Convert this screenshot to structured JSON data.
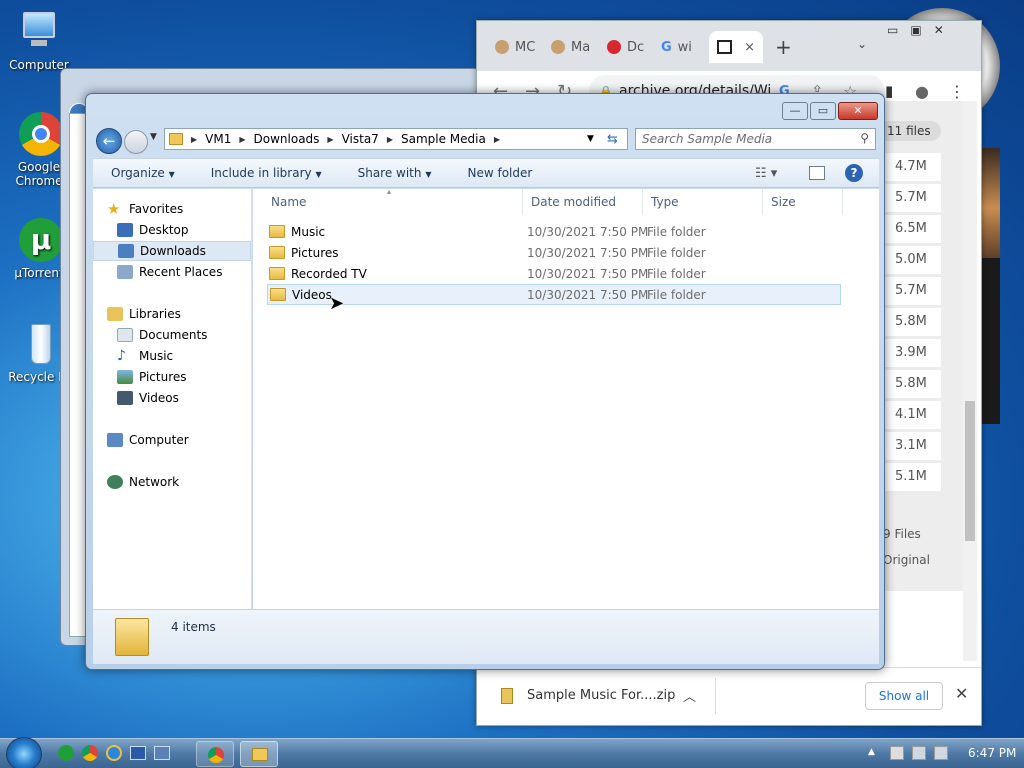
{
  "desktop": {
    "icons": [
      {
        "label": "Computer"
      },
      {
        "label": "Google Chrome",
        "line1": "Google",
        "line2": "Chrome"
      },
      {
        "label": "µTorrent"
      },
      {
        "label": "Recycle Bi"
      }
    ]
  },
  "chrome": {
    "tabs": [
      {
        "label": "MC"
      },
      {
        "label": "Ma"
      },
      {
        "label": "Dc"
      },
      {
        "label": "wi"
      },
      {
        "label": ""
      }
    ],
    "new_tab": "+",
    "url": "archive.org/details/Wi...",
    "files_count": "11 files",
    "sizes": [
      "4.7M",
      "5.7M",
      "6.5M",
      "5.0M",
      "5.7M",
      "5.8M",
      "3.9M",
      "5.8M",
      "4.1M",
      "3.1M",
      "5.1M"
    ],
    "files_footer": "9 Files",
    "original_label": "Original",
    "download": {
      "filename": "Sample Music For....zip",
      "show_all": "Show all"
    }
  },
  "explorer": {
    "breadcrumb": [
      "VM1",
      "Downloads",
      "Vista7",
      "Sample Media"
    ],
    "search_placeholder": "Search Sample Media",
    "commands": {
      "organize": "Organize",
      "include": "Include in library",
      "share": "Share with",
      "new_folder": "New folder"
    },
    "nav": {
      "favorites": "Favorites",
      "desktop": "Desktop",
      "downloads": "Downloads",
      "recent": "Recent Places",
      "libraries": "Libraries",
      "documents": "Documents",
      "music": "Music",
      "pictures": "Pictures",
      "videos": "Videos",
      "computer": "Computer",
      "network": "Network"
    },
    "columns": {
      "name": "Name",
      "date": "Date modified",
      "type": "Type",
      "size": "Size"
    },
    "rows": [
      {
        "name": "Music",
        "date": "10/30/2021 7:50 PM",
        "type": "File folder"
      },
      {
        "name": "Pictures",
        "date": "10/30/2021 7:50 PM",
        "type": "File folder"
      },
      {
        "name": "Recorded TV",
        "date": "10/30/2021 7:50 PM",
        "type": "File folder"
      },
      {
        "name": "Videos",
        "date": "10/30/2021 7:50 PM",
        "type": "File folder"
      }
    ],
    "status": "4 items"
  },
  "taskbar": {
    "time": "6:47 PM"
  }
}
